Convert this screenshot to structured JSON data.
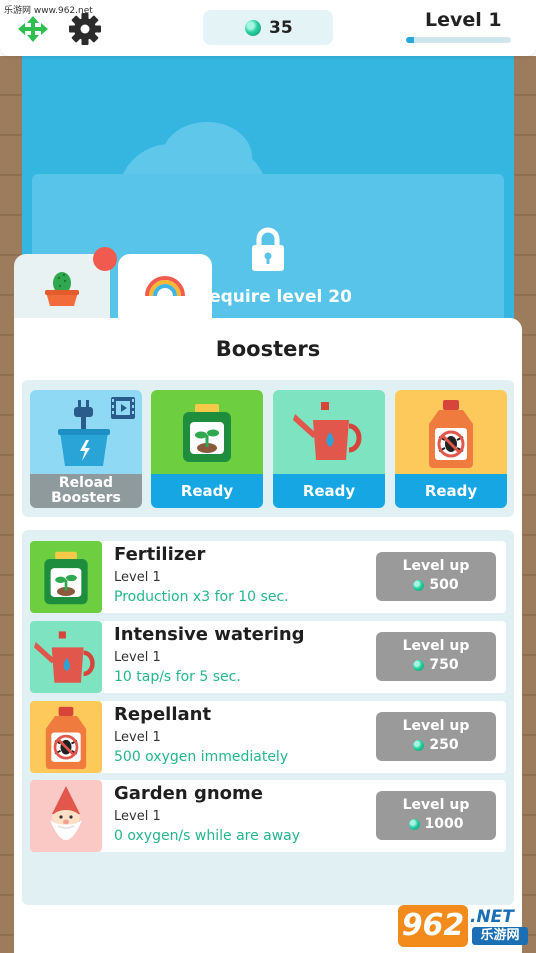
{
  "watermark": "乐游网 www.962.net",
  "topbar": {
    "oxygen_count": "35",
    "level_label": "Level 1",
    "level_progress": 0.08
  },
  "locked_area": {
    "text": "Require level 20"
  },
  "panel": {
    "title": "Boosters"
  },
  "boosters": [
    {
      "name": "reload",
      "label": "Reload Boosters"
    },
    {
      "name": "fertilizer",
      "label": "Ready"
    },
    {
      "name": "watering",
      "label": "Ready"
    },
    {
      "name": "repellant",
      "label": "Ready"
    }
  ],
  "upgrades": [
    {
      "name": "Fertilizer",
      "level": "Level 1",
      "desc": "Production x3 for 10 sec.",
      "button": "Level up",
      "cost": "500"
    },
    {
      "name": "Intensive watering",
      "level": "Level 1",
      "desc": "10 tap/s for 5 sec.",
      "button": "Level up",
      "cost": "750"
    },
    {
      "name": "Repellant",
      "level": "Level 1",
      "desc": "500 oxygen immediately",
      "button": "Level up",
      "cost": "250"
    },
    {
      "name": "Garden gnome",
      "level": "Level 1",
      "desc": "0 oxygen/s while are away",
      "button": "Level up",
      "cost": "1000"
    }
  ],
  "logo": {
    "num": "962",
    "net": ".NET",
    "cn": "乐游网"
  },
  "colors": {
    "sky": "#35b6e1",
    "ready": "#15a6e3",
    "accent_text": "#24b58f",
    "button_gray": "#9a9a9a"
  }
}
